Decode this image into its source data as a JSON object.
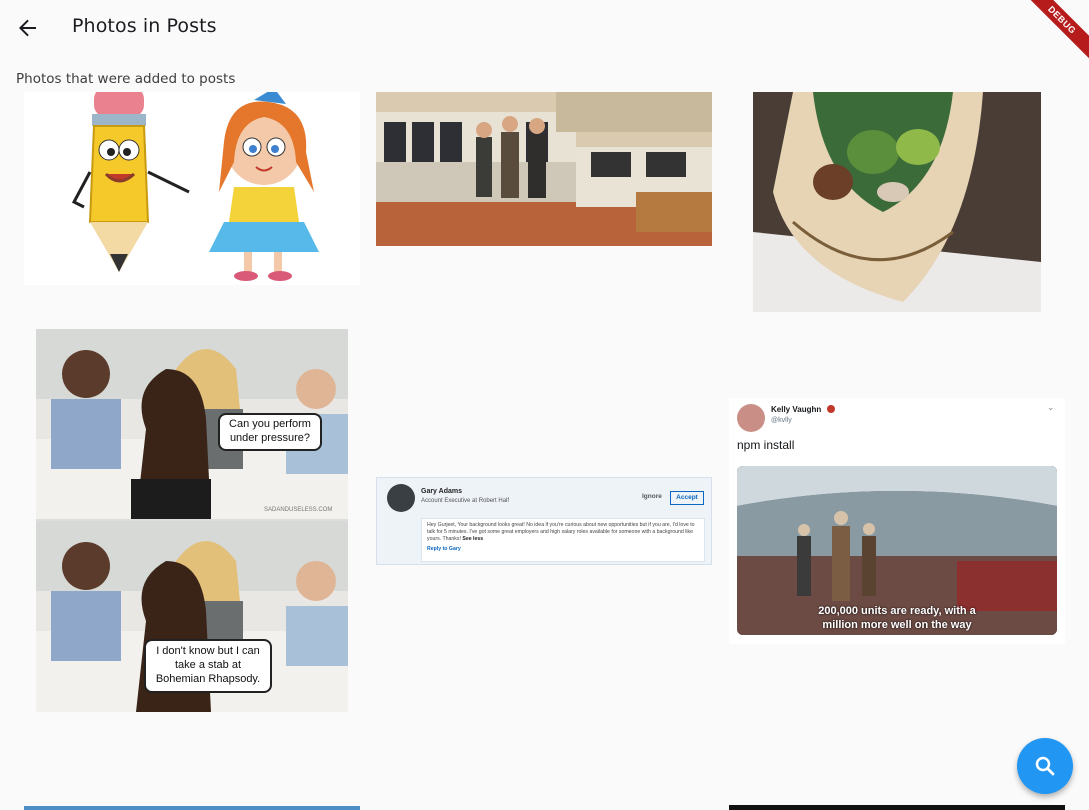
{
  "header": {
    "title": "Photos in Posts",
    "back_icon": "arrow-back-icon",
    "debug_banner": "DEBUG"
  },
  "subtitle": "Photos that were added to posts",
  "photos": {
    "meme_top": {
      "caption": "Can you perform under pressure?",
      "watermark": "SADANDUSELESS.COM"
    },
    "meme_bottom": {
      "caption": "I don't know but I can take a stab at Bohemian Rhapsody."
    },
    "linkedin": {
      "name": "Gary Adams",
      "role": "Account Executive at Robert Half",
      "ignore": "Ignore",
      "accept": "Accept",
      "message": "Hey Gurjeet, Your background looks great! No idea if you're curious about new opportunities but if you are, I'd love to talk for 5 minutes. I've got some great employers and high salary roles available for someone with a background like yours. Thanks!",
      "see_less": "See less",
      "reply": "Reply to Gary"
    },
    "tweet": {
      "name": "Kelly Vaughn",
      "handle": "@kvlly",
      "text": "npm install",
      "subtitle_line1": "200,000 units are ready, with a",
      "subtitle_line2": "million more well on the way"
    }
  },
  "fab": {
    "icon": "search-icon"
  },
  "colors": {
    "accent": "#2196f3",
    "debug": "#b71c1c",
    "background": "#fafafa"
  }
}
